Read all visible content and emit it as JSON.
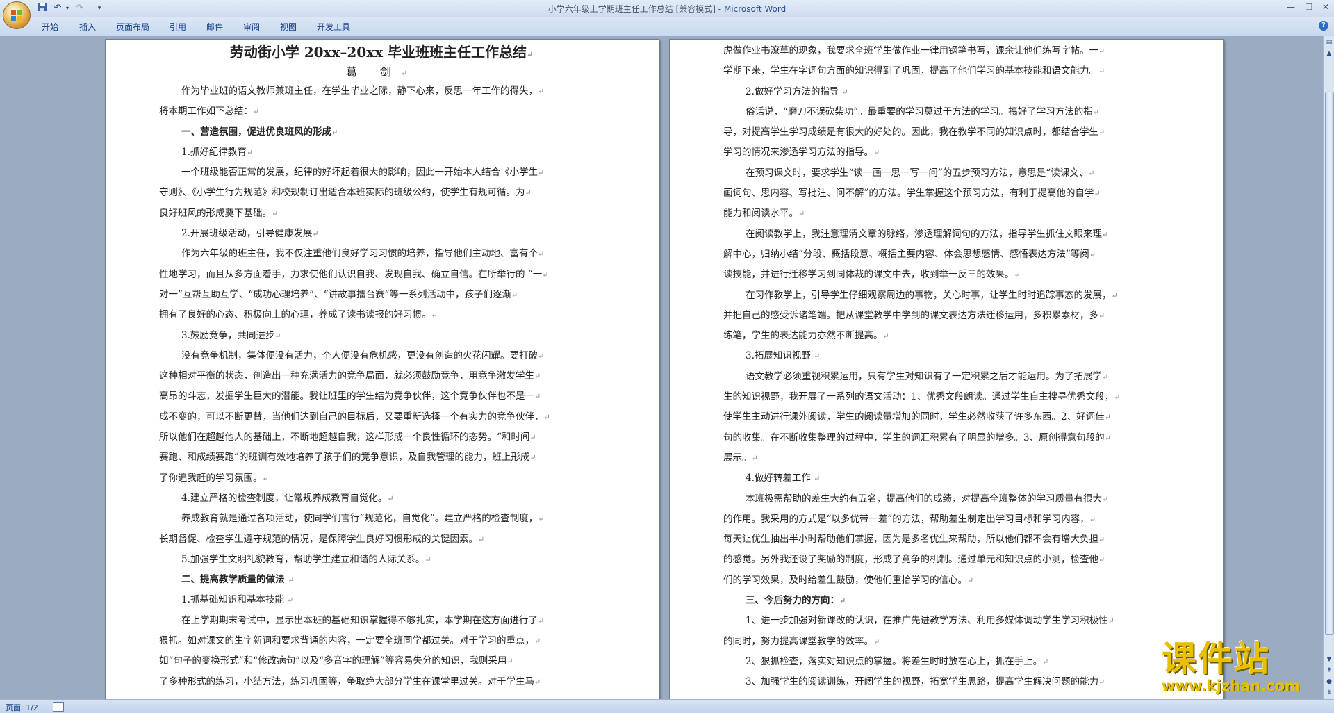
{
  "window": {
    "title_doc": "小学六年级上学期班主任工作总结 [兼容模式]",
    "title_sep": " - ",
    "title_app": "Microsoft Word"
  },
  "ribbon": {
    "tabs": [
      "开始",
      "插入",
      "页面布局",
      "引用",
      "邮件",
      "审阅",
      "视图",
      "开发工具"
    ]
  },
  "status": {
    "page_count": "页面: 1/2"
  },
  "watermark": {
    "brand": "课件站",
    "url": "www.kjzhan.com"
  },
  "colors": {
    "accent": "#15428b",
    "watermark": "#e8c000"
  },
  "document": {
    "left_page": [
      {
        "type": "title",
        "text": "劳动街小学 20xx–20xx 毕业班班主任工作总结"
      },
      {
        "type": "author",
        "text": "葛  剑"
      },
      {
        "type": "ind",
        "text": "作为毕业班的语文教师兼班主任，在学生毕业之际，静下心来，反思一年工作的得失，"
      },
      {
        "type": "plain",
        "text": "将本期工作如下总结："
      },
      {
        "type": "bold",
        "text": "一、营造氛围，促进优良班风的形成"
      },
      {
        "type": "ind",
        "text": "1.抓好纪律教育"
      },
      {
        "type": "ind",
        "text": "一个班级能否正常的发展，纪律的好坏起着很大的影响，因此一开始本人结合《小学生"
      },
      {
        "type": "plain",
        "text": "守则》、《小学生行为规范》和校规制订出适合本班实际的班级公约，使学生有规可循。为"
      },
      {
        "type": "plain",
        "text": "良好班风的形成奠下基础。"
      },
      {
        "type": "ind",
        "text": "2.开展班级活动，引导健康发展"
      },
      {
        "type": "ind",
        "text": "作为六年级的班主任，我不仅注重他们良好学习习惯的培养，指导他们主动地、富有个"
      },
      {
        "type": "plain",
        "text": "性地学习，而且从多方面着手，力求使他们认识自我、发现自我、确立自信。在所举行的  “一"
      },
      {
        "type": "plain",
        "text": "对一”互帮互助互学、“成功心理培养”、“讲故事擂台赛”等一系列活动中，孩子们逐渐"
      },
      {
        "type": "plain",
        "text": "拥有了良好的心态、积极向上的心理，养成了读书读报的好习惯。"
      },
      {
        "type": "ind",
        "text": "3.鼓励竞争，共同进步"
      },
      {
        "type": "ind",
        "text": "没有竞争机制，集体便没有活力，个人便没有危机感，更没有创造的火花闪耀。要打破"
      },
      {
        "type": "plain",
        "text": "这种相对平衡的状态，创造出一种充满活力的竞争局面，就必须鼓励竞争，用竞争激发学生"
      },
      {
        "type": "plain",
        "text": "高昂的斗志，发掘学生巨大的潜能。我让班里的学生结为竞争伙伴，这个竞争伙伴也不是一"
      },
      {
        "type": "plain",
        "text": "成不变的，可以不断更替，当他们达到自己的目标后，又要重新选择一个有实力的竞争伙伴，"
      },
      {
        "type": "plain",
        "text": "所以他们在超越他人的基础上，不断地超越自我，这样形成一个良性循环的态势。“和时间"
      },
      {
        "type": "plain",
        "text": "赛跑、和成绩赛跑”的班训有效地培养了孩子们的竞争意识，及自我管理的能力，班上形成"
      },
      {
        "type": "plain",
        "text": "了你追我赶的学习氛围。"
      },
      {
        "type": "ind",
        "text": "4.建立严格的检查制度，让常规养成教育自觉化。"
      },
      {
        "type": "ind",
        "text": "养成教育就是通过各项活动，使同学们言行“规范化，自觉化”。建立严格的检查制度，"
      },
      {
        "type": "plain",
        "text": "长期督促、检查学生遵守规范的情况，是保障学生良好习惯形成的关键因素。"
      },
      {
        "type": "ind",
        "text": "5.加强学生文明礼貌教育，帮助学生建立和谐的人际关系。"
      },
      {
        "type": "bold",
        "text": "二、提高教学质量的做法 "
      },
      {
        "type": "ind",
        "text": "1.抓基础知识和基本技能 "
      },
      {
        "type": "ind",
        "text": "在上学期期末考试中，显示出本班的基础知识掌握得不够扎实，本学期在这方面进行了"
      },
      {
        "type": "plain",
        "text": "狠抓。如对课文的生字新词和要求背诵的内容，一定要全班同学都过关。对于学习的重点，"
      },
      {
        "type": "plain",
        "text": "如“句子的变换形式”和“修改病句”以及“多音字的理解”等容易失分的知识，我则采用"
      },
      {
        "type": "plain",
        "text": "了多种形式的练习，小结方法，练习巩固等，争取绝大部分学生在课堂里过关。对于学生马"
      }
    ],
    "right_page": [
      {
        "type": "plain",
        "text": "虎做作业书潦草的现象，我要求全班学生做作业一律用钢笔书写，课余让他们练写字帖。一"
      },
      {
        "type": "plain",
        "text": "学期下来，学生在字词句方面的知识得到了巩固，提高了他们学习的基本技能和语文能力。"
      },
      {
        "type": "ind",
        "text": "2.做好学习方法的指导 "
      },
      {
        "type": "ind",
        "text": "俗话说，“磨刀不误砍柴功”。最重要的学习莫过于方法的学习。搞好了学习方法的指"
      },
      {
        "type": "plain",
        "text": "导，对提高学生学习成绩是有很大的好处的。因此，我在教学不同的知识点时，都结合学生"
      },
      {
        "type": "plain",
        "text": "学习的情况来渗透学习方法的指导。"
      },
      {
        "type": "ind",
        "text": "在预习课文时，要求学生“读一画一思一写一问”的五步预习方法，意思是“读课文、"
      },
      {
        "type": "plain",
        "text": "画词句、思内容、写批注、问不解”的方法。学生掌握这个预习方法，有利于提高他的自学"
      },
      {
        "type": "plain",
        "text": "能力和阅读水平。"
      },
      {
        "type": "ind",
        "text": "在阅读教学上，我注意理清文章的脉络，渗透理解词句的方法，指导学生抓住文眼来理"
      },
      {
        "type": "plain",
        "text": "解中心，归纳小结“分段、概括段意、概括主要内容、体会思想感情、感悟表达方法”等阅"
      },
      {
        "type": "plain",
        "text": "读技能，并进行迁移学习到同体裁的课文中去，收到举一反三的效果。"
      },
      {
        "type": "ind",
        "text": "在习作教学上，引导学生仔细观察周边的事物，关心时事，让学生时时追踪事态的发展，"
      },
      {
        "type": "plain",
        "text": "并把自己的感受诉诸笔端。把从课堂教学中学到的课文表达方法迁移运用，多积累素材，多"
      },
      {
        "type": "plain",
        "text": "练笔，学生的表达能力亦然不断提高。"
      },
      {
        "type": "ind",
        "text": "3.拓展知识视野 "
      },
      {
        "type": "ind",
        "text": "语文教学必须重视积累运用，只有学生对知识有了一定积累之后才能运用。为了拓展学"
      },
      {
        "type": "plain",
        "text": "生的知识视野，我开展了一系列的语文活动：1、优秀文段朗读。通过学生自主搜寻优秀文段，"
      },
      {
        "type": "plain",
        "text": "使学生主动进行课外阅读，学生的阅读量增加的同时，学生必然收获了许多东西。2、好词佳"
      },
      {
        "type": "plain",
        "text": "句的收集。在不断收集整理的过程中，学生的词汇积累有了明显的增多。3、原创得意句段的"
      },
      {
        "type": "plain",
        "text": "展示。"
      },
      {
        "type": "ind",
        "text": "4.做好转差工作 "
      },
      {
        "type": "ind",
        "text": "本班极需帮助的差生大约有五名，提高他们的成绩，对提高全班整体的学习质量有很大"
      },
      {
        "type": "plain",
        "text": "的作用。我采用的方式是“以多优带一差”的方法，帮助差生制定出学习目标和学习内容，"
      },
      {
        "type": "plain",
        "text": "每天让优生抽出半小时帮助他们掌握，因为是多名优生来帮助，所以他们都不会有增大负担"
      },
      {
        "type": "plain",
        "text": "的感觉。另外我还设了奖励的制度，形成了竞争的机制。通过单元和知识点的小测，检查他"
      },
      {
        "type": "plain",
        "text": "们的学习效果，及时给差生鼓励，使他们重拾学习的信心。"
      },
      {
        "type": "bold",
        "text": "三、今后努力的方向："
      },
      {
        "type": "ind",
        "text": "1、进一步加强对新课改的认识，在推广先进教学方法、利用多媒体调动学生学习积极性"
      },
      {
        "type": "plain",
        "text": "的同时，努力提高课堂教学的效率。"
      },
      {
        "type": "ind",
        "text": "2、狠抓检查，落实对知识点的掌握。将差生时时放在心上，抓在手上。"
      },
      {
        "type": "ind",
        "text": "3、加强学生的阅读训练，开阔学生的视野，拓宽学生思路，提高学生解决问题的能力"
      }
    ]
  }
}
